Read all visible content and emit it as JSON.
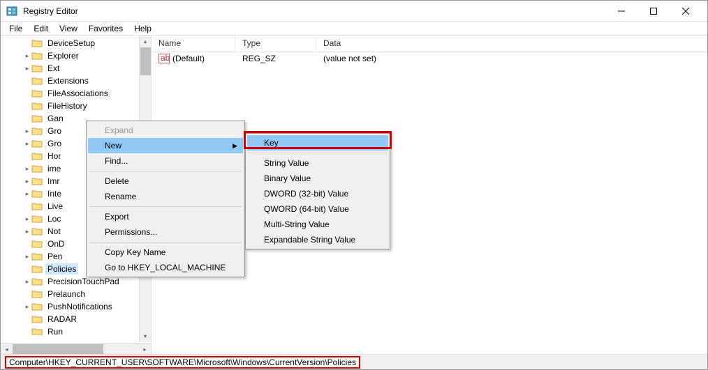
{
  "titlebar": {
    "title": "Registry Editor"
  },
  "menubar": {
    "items": [
      "File",
      "Edit",
      "View",
      "Favorites",
      "Help"
    ]
  },
  "tree": {
    "items": [
      {
        "label": "DeviceSetup",
        "chevron": ""
      },
      {
        "label": "Explorer",
        "chevron": "▸"
      },
      {
        "label": "Ext",
        "chevron": "▸"
      },
      {
        "label": "Extensions",
        "chevron": ""
      },
      {
        "label": "FileAssociations",
        "chevron": ""
      },
      {
        "label": "FileHistory",
        "chevron": ""
      },
      {
        "label": "Gan",
        "chevron": ""
      },
      {
        "label": "Gro",
        "chevron": "▸"
      },
      {
        "label": "Gro",
        "chevron": "▸"
      },
      {
        "label": "Hor",
        "chevron": ""
      },
      {
        "label": "ime",
        "chevron": "▸"
      },
      {
        "label": "Imr",
        "chevron": "▸"
      },
      {
        "label": "Inte",
        "chevron": "▸"
      },
      {
        "label": "Live",
        "chevron": ""
      },
      {
        "label": "Loc",
        "chevron": "▸"
      },
      {
        "label": "Not",
        "chevron": "▸"
      },
      {
        "label": "OnD",
        "chevron": ""
      },
      {
        "label": "Pen",
        "chevron": "▸"
      },
      {
        "label": "Policies",
        "chevron": "",
        "selected": true
      },
      {
        "label": "PrecisionTouchPad",
        "chevron": "▸"
      },
      {
        "label": "Prelaunch",
        "chevron": ""
      },
      {
        "label": "PushNotifications",
        "chevron": "▸"
      },
      {
        "label": "RADAR",
        "chevron": ""
      },
      {
        "label": "Run",
        "chevron": ""
      }
    ]
  },
  "list": {
    "headers": {
      "name": "Name",
      "type": "Type",
      "data": "Data"
    },
    "rows": [
      {
        "name": "(Default)",
        "type": "REG_SZ",
        "data": "(value not set)"
      }
    ]
  },
  "ctx_main": {
    "items": [
      {
        "label": "Expand",
        "disabled": true
      },
      {
        "label": "New",
        "submenu": true,
        "hover": true
      },
      {
        "label": "Find...",
        "sepAfter": true
      },
      {
        "label": "Delete"
      },
      {
        "label": "Rename",
        "sepAfter": true
      },
      {
        "label": "Export"
      },
      {
        "label": "Permissions...",
        "sepAfter": true
      },
      {
        "label": "Copy Key Name"
      },
      {
        "label": "Go to HKEY_LOCAL_MACHINE"
      }
    ]
  },
  "ctx_sub": {
    "items": [
      {
        "label": "Key",
        "hover": true,
        "sepAfter": true
      },
      {
        "label": "String Value"
      },
      {
        "label": "Binary Value"
      },
      {
        "label": "DWORD (32-bit) Value"
      },
      {
        "label": "QWORD (64-bit) Value"
      },
      {
        "label": "Multi-String Value"
      },
      {
        "label": "Expandable String Value"
      }
    ]
  },
  "statusbar": {
    "path": "Computer\\HKEY_CURRENT_USER\\SOFTWARE\\Microsoft\\Windows\\CurrentVersion\\Policies"
  }
}
